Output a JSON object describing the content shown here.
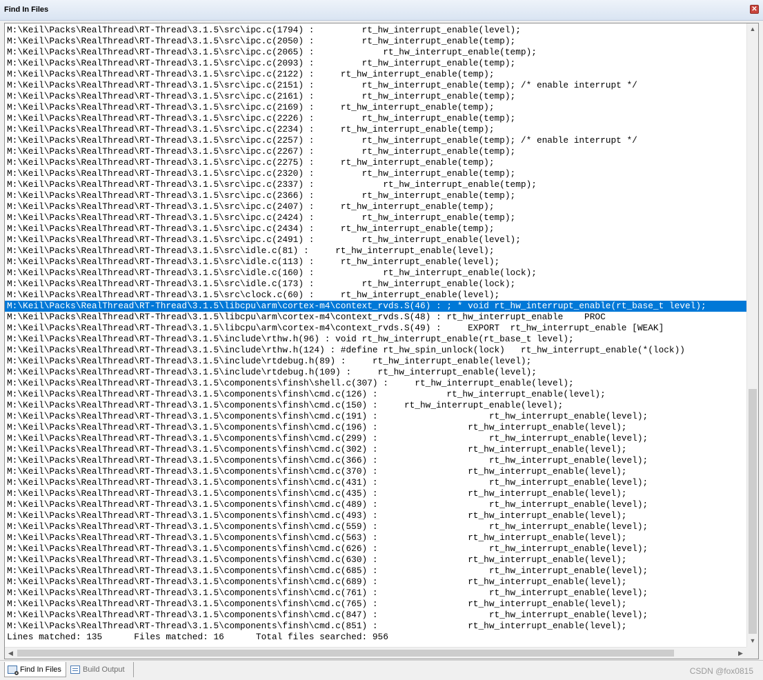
{
  "window": {
    "title": "Find In Files"
  },
  "results": {
    "selected_index": 25,
    "lines": [
      "M:\\Keil\\Packs\\RealThread\\RT-Thread\\3.1.5\\src\\ipc.c(1794) :         rt_hw_interrupt_enable(level);",
      "M:\\Keil\\Packs\\RealThread\\RT-Thread\\3.1.5\\src\\ipc.c(2050) :         rt_hw_interrupt_enable(temp);",
      "M:\\Keil\\Packs\\RealThread\\RT-Thread\\3.1.5\\src\\ipc.c(2065) :             rt_hw_interrupt_enable(temp);",
      "M:\\Keil\\Packs\\RealThread\\RT-Thread\\3.1.5\\src\\ipc.c(2093) :         rt_hw_interrupt_enable(temp);",
      "M:\\Keil\\Packs\\RealThread\\RT-Thread\\3.1.5\\src\\ipc.c(2122) :     rt_hw_interrupt_enable(temp);",
      "M:\\Keil\\Packs\\RealThread\\RT-Thread\\3.1.5\\src\\ipc.c(2151) :         rt_hw_interrupt_enable(temp); /* enable interrupt */",
      "M:\\Keil\\Packs\\RealThread\\RT-Thread\\3.1.5\\src\\ipc.c(2161) :         rt_hw_interrupt_enable(temp);",
      "M:\\Keil\\Packs\\RealThread\\RT-Thread\\3.1.5\\src\\ipc.c(2169) :     rt_hw_interrupt_enable(temp);",
      "M:\\Keil\\Packs\\RealThread\\RT-Thread\\3.1.5\\src\\ipc.c(2226) :         rt_hw_interrupt_enable(temp);",
      "M:\\Keil\\Packs\\RealThread\\RT-Thread\\3.1.5\\src\\ipc.c(2234) :     rt_hw_interrupt_enable(temp);",
      "M:\\Keil\\Packs\\RealThread\\RT-Thread\\3.1.5\\src\\ipc.c(2257) :         rt_hw_interrupt_enable(temp); /* enable interrupt */",
      "M:\\Keil\\Packs\\RealThread\\RT-Thread\\3.1.5\\src\\ipc.c(2267) :         rt_hw_interrupt_enable(temp);",
      "M:\\Keil\\Packs\\RealThread\\RT-Thread\\3.1.5\\src\\ipc.c(2275) :     rt_hw_interrupt_enable(temp);",
      "M:\\Keil\\Packs\\RealThread\\RT-Thread\\3.1.5\\src\\ipc.c(2320) :         rt_hw_interrupt_enable(temp);",
      "M:\\Keil\\Packs\\RealThread\\RT-Thread\\3.1.5\\src\\ipc.c(2337) :             rt_hw_interrupt_enable(temp);",
      "M:\\Keil\\Packs\\RealThread\\RT-Thread\\3.1.5\\src\\ipc.c(2366) :         rt_hw_interrupt_enable(temp);",
      "M:\\Keil\\Packs\\RealThread\\RT-Thread\\3.1.5\\src\\ipc.c(2407) :     rt_hw_interrupt_enable(temp);",
      "M:\\Keil\\Packs\\RealThread\\RT-Thread\\3.1.5\\src\\ipc.c(2424) :         rt_hw_interrupt_enable(temp);",
      "M:\\Keil\\Packs\\RealThread\\RT-Thread\\3.1.5\\src\\ipc.c(2434) :     rt_hw_interrupt_enable(temp);",
      "M:\\Keil\\Packs\\RealThread\\RT-Thread\\3.1.5\\src\\ipc.c(2491) :         rt_hw_interrupt_enable(level);",
      "M:\\Keil\\Packs\\RealThread\\RT-Thread\\3.1.5\\src\\idle.c(81) :     rt_hw_interrupt_enable(level);",
      "M:\\Keil\\Packs\\RealThread\\RT-Thread\\3.1.5\\src\\idle.c(113) :     rt_hw_interrupt_enable(level);",
      "M:\\Keil\\Packs\\RealThread\\RT-Thread\\3.1.5\\src\\idle.c(160) :             rt_hw_interrupt_enable(lock);",
      "M:\\Keil\\Packs\\RealThread\\RT-Thread\\3.1.5\\src\\idle.c(173) :         rt_hw_interrupt_enable(lock);",
      "M:\\Keil\\Packs\\RealThread\\RT-Thread\\3.1.5\\src\\clock.c(60) :     rt_hw_interrupt_enable(level);",
      "M:\\Keil\\Packs\\RealThread\\RT-Thread\\3.1.5\\libcpu\\arm\\cortex-m4\\context_rvds.S(46) : ; * void rt_hw_interrupt_enable(rt_base_t level);",
      "M:\\Keil\\Packs\\RealThread\\RT-Thread\\3.1.5\\libcpu\\arm\\cortex-m4\\context_rvds.S(48) : rt_hw_interrupt_enable    PROC",
      "M:\\Keil\\Packs\\RealThread\\RT-Thread\\3.1.5\\libcpu\\arm\\cortex-m4\\context_rvds.S(49) :     EXPORT  rt_hw_interrupt_enable [WEAK]",
      "M:\\Keil\\Packs\\RealThread\\RT-Thread\\3.1.5\\include\\rthw.h(96) : void rt_hw_interrupt_enable(rt_base_t level);",
      "M:\\Keil\\Packs\\RealThread\\RT-Thread\\3.1.5\\include\\rthw.h(124) : #define rt_hw_spin_unlock(lock)   rt_hw_interrupt_enable(*(lock))",
      "M:\\Keil\\Packs\\RealThread\\RT-Thread\\3.1.5\\include\\rtdebug.h(89) :     rt_hw_interrupt_enable(level);",
      "M:\\Keil\\Packs\\RealThread\\RT-Thread\\3.1.5\\include\\rtdebug.h(109) :     rt_hw_interrupt_enable(level);",
      "M:\\Keil\\Packs\\RealThread\\RT-Thread\\3.1.5\\components\\finsh\\shell.c(307) :     rt_hw_interrupt_enable(level);",
      "M:\\Keil\\Packs\\RealThread\\RT-Thread\\3.1.5\\components\\finsh\\cmd.c(126) :             rt_hw_interrupt_enable(level);",
      "M:\\Keil\\Packs\\RealThread\\RT-Thread\\3.1.5\\components\\finsh\\cmd.c(150) :     rt_hw_interrupt_enable(level);",
      "M:\\Keil\\Packs\\RealThread\\RT-Thread\\3.1.5\\components\\finsh\\cmd.c(191) :                     rt_hw_interrupt_enable(level);",
      "M:\\Keil\\Packs\\RealThread\\RT-Thread\\3.1.5\\components\\finsh\\cmd.c(196) :                 rt_hw_interrupt_enable(level);",
      "M:\\Keil\\Packs\\RealThread\\RT-Thread\\3.1.5\\components\\finsh\\cmd.c(299) :                     rt_hw_interrupt_enable(level);",
      "M:\\Keil\\Packs\\RealThread\\RT-Thread\\3.1.5\\components\\finsh\\cmd.c(302) :                 rt_hw_interrupt_enable(level);",
      "M:\\Keil\\Packs\\RealThread\\RT-Thread\\3.1.5\\components\\finsh\\cmd.c(366) :                     rt_hw_interrupt_enable(level);",
      "M:\\Keil\\Packs\\RealThread\\RT-Thread\\3.1.5\\components\\finsh\\cmd.c(370) :                 rt_hw_interrupt_enable(level);",
      "M:\\Keil\\Packs\\RealThread\\RT-Thread\\3.1.5\\components\\finsh\\cmd.c(431) :                     rt_hw_interrupt_enable(level);",
      "M:\\Keil\\Packs\\RealThread\\RT-Thread\\3.1.5\\components\\finsh\\cmd.c(435) :                 rt_hw_interrupt_enable(level);",
      "M:\\Keil\\Packs\\RealThread\\RT-Thread\\3.1.5\\components\\finsh\\cmd.c(489) :                     rt_hw_interrupt_enable(level);",
      "M:\\Keil\\Packs\\RealThread\\RT-Thread\\3.1.5\\components\\finsh\\cmd.c(493) :                 rt_hw_interrupt_enable(level);",
      "M:\\Keil\\Packs\\RealThread\\RT-Thread\\3.1.5\\components\\finsh\\cmd.c(559) :                     rt_hw_interrupt_enable(level);",
      "M:\\Keil\\Packs\\RealThread\\RT-Thread\\3.1.5\\components\\finsh\\cmd.c(563) :                 rt_hw_interrupt_enable(level);",
      "M:\\Keil\\Packs\\RealThread\\RT-Thread\\3.1.5\\components\\finsh\\cmd.c(626) :                     rt_hw_interrupt_enable(level);",
      "M:\\Keil\\Packs\\RealThread\\RT-Thread\\3.1.5\\components\\finsh\\cmd.c(630) :                 rt_hw_interrupt_enable(level);",
      "M:\\Keil\\Packs\\RealThread\\RT-Thread\\3.1.5\\components\\finsh\\cmd.c(685) :                     rt_hw_interrupt_enable(level);",
      "M:\\Keil\\Packs\\RealThread\\RT-Thread\\3.1.5\\components\\finsh\\cmd.c(689) :                 rt_hw_interrupt_enable(level);",
      "M:\\Keil\\Packs\\RealThread\\RT-Thread\\3.1.5\\components\\finsh\\cmd.c(761) :                     rt_hw_interrupt_enable(level);",
      "M:\\Keil\\Packs\\RealThread\\RT-Thread\\3.1.5\\components\\finsh\\cmd.c(765) :                 rt_hw_interrupt_enable(level);",
      "M:\\Keil\\Packs\\RealThread\\RT-Thread\\3.1.5\\components\\finsh\\cmd.c(847) :                     rt_hw_interrupt_enable(level);",
      "M:\\Keil\\Packs\\RealThread\\RT-Thread\\3.1.5\\components\\finsh\\cmd.c(851) :                 rt_hw_interrupt_enable(level);",
      "Lines matched: 135      Files matched: 16      Total files searched: 956"
    ]
  },
  "tabs": [
    {
      "label": "Find In Files",
      "icon": "find-in-files-icon",
      "active": true
    },
    {
      "label": "Build Output",
      "icon": "build-output-icon",
      "active": false
    }
  ],
  "watermark": "CSDN @fox0815",
  "colors": {
    "selection": "#0078d7",
    "close": "#c9453d"
  }
}
